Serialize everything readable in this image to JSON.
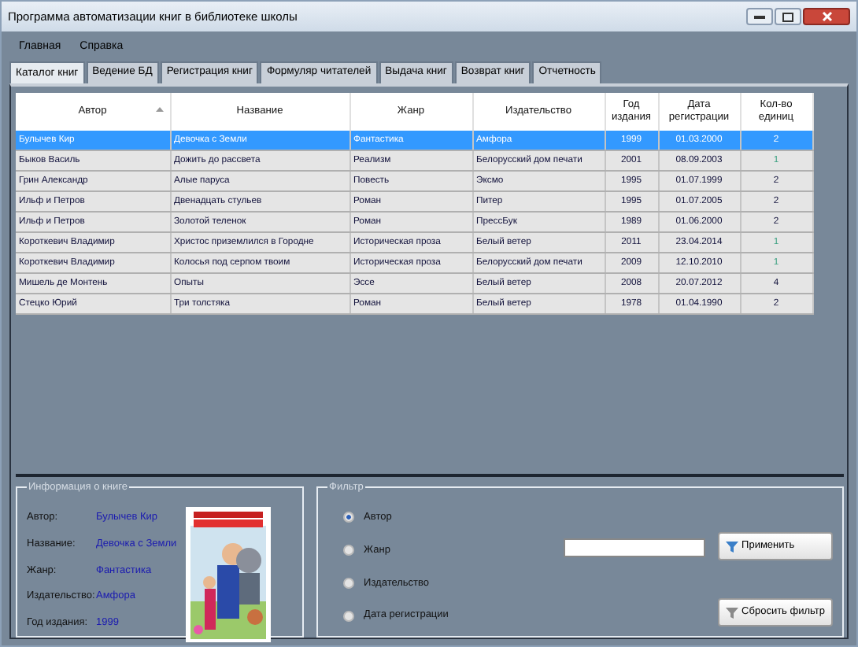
{
  "window": {
    "title": "Программа автоматизации книг в библиотеке школы"
  },
  "menu": [
    "Главная",
    "Справка"
  ],
  "tabs": [
    {
      "label": "Каталог книг",
      "selected": true
    },
    {
      "label": "Ведение БД",
      "selected": false
    },
    {
      "label": "Регистрация книг",
      "selected": false
    },
    {
      "label": "Формуляр читателей",
      "selected": false
    },
    {
      "label": "Выдача книг",
      "selected": false
    },
    {
      "label": "Возврат книг",
      "selected": false
    },
    {
      "label": "Отчетность",
      "selected": false
    }
  ],
  "table": {
    "columns": [
      {
        "label": "Автор",
        "sorted": true
      },
      {
        "label": "Название",
        "sorted": false
      },
      {
        "label": "Жанр",
        "sorted": false
      },
      {
        "label": "Издательство",
        "sorted": false
      },
      {
        "label": "Год издания",
        "sorted": false
      },
      {
        "label": "Дата регистрации",
        "sorted": false
      },
      {
        "label": "Кол-во единиц",
        "sorted": false
      }
    ],
    "rows": [
      {
        "cells": [
          "Булычев Кир",
          "Девочка с Земли",
          "Фантастика",
          "Амфора",
          "1999",
          "01.03.2000",
          "2"
        ],
        "selected": true,
        "low": false
      },
      {
        "cells": [
          "Быков Василь",
          "Дожить до рассвета",
          "Реализм",
          "Белорусский дом печати",
          "2001",
          "08.09.2003",
          "1"
        ],
        "selected": false,
        "low": true
      },
      {
        "cells": [
          "Грин Александр",
          "Алые паруса",
          "Повесть",
          "Эксмо",
          "1995",
          "01.07.1999",
          "2"
        ],
        "selected": false,
        "low": false
      },
      {
        "cells": [
          "Ильф и Петров",
          "Двенадцать стульев",
          "Роман",
          "Питер",
          "1995",
          "01.07.2005",
          "2"
        ],
        "selected": false,
        "low": false
      },
      {
        "cells": [
          "Ильф и Петров",
          "Золотой теленок",
          "Роман",
          "ПрессБук",
          "1989",
          "01.06.2000",
          "2"
        ],
        "selected": false,
        "low": false
      },
      {
        "cells": [
          "Короткевич Владимир",
          "Христос приземлился в Городне",
          "Историческая проза",
          "Белый ветер",
          "2011",
          "23.04.2014",
          "1"
        ],
        "selected": false,
        "low": true
      },
      {
        "cells": [
          "Короткевич Владимир",
          "Колосья под серпом твоим",
          "Историческая проза",
          "Белорусский дом печати",
          "2009",
          "12.10.2010",
          "1"
        ],
        "selected": false,
        "low": true
      },
      {
        "cells": [
          "Мишель де Монтень",
          "Опыты",
          "Эссе",
          "Белый ветер",
          "2008",
          "20.07.2012",
          "4"
        ],
        "selected": false,
        "low": false
      },
      {
        "cells": [
          "Стецко Юрий",
          "Три толстяка",
          "Роман",
          "Белый ветер",
          "1978",
          "01.04.1990",
          "2"
        ],
        "selected": false,
        "low": false
      }
    ]
  },
  "book_info": {
    "title": "Информация о книге",
    "fields": [
      {
        "label": "Автор:",
        "value": "Булычев Кир"
      },
      {
        "label": "Название:",
        "value": "Девочка с Земли"
      },
      {
        "label": "Жанр:",
        "value": "Фантастика"
      },
      {
        "label": "Издательство:",
        "value": "Амфора"
      },
      {
        "label": "Год издания:",
        "value": "1999"
      }
    ]
  },
  "filter": {
    "title": "Фильтр",
    "options": [
      {
        "label": "Автор",
        "selected": true
      },
      {
        "label": "Жанр",
        "selected": false
      },
      {
        "label": "Издательство",
        "selected": false
      },
      {
        "label": "Дата регистрации",
        "selected": false
      }
    ],
    "buttons": [
      "Применить",
      "Сбросить фильтр"
    ]
  }
}
